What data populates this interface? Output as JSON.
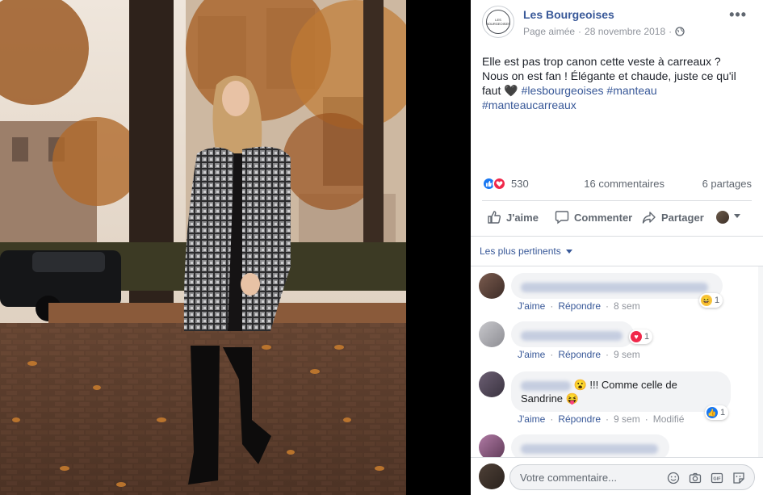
{
  "post": {
    "page_name": "Les Bourgeoises",
    "page_logo_text": "LES BOURGEOISES",
    "meta_status": "Page aimée",
    "meta_sep": "·",
    "meta_date": "28 novembre 2018",
    "meta_sep2": "·",
    "text_line1": "Elle est pas trop canon cette veste à carreaux ?",
    "text_line2": "Nous on est fan ! Élégante et chaude, juste ce qu'il",
    "text_line3_prefix": "faut 🖤 ",
    "hashtag1": "#lesbourgeoises",
    "hashtag2": "#manteau",
    "hashtag3": "#manteaucarreaux",
    "reactions_count": "530",
    "comments_count": "16 commentaires",
    "shares_count": "6 partages"
  },
  "actions": {
    "like": "J'aime",
    "comment": "Commenter",
    "share": "Partager"
  },
  "sort": {
    "label": "Les plus pertinents"
  },
  "comments": [
    {
      "text": "",
      "like": "J'aime",
      "reply": "Répondre",
      "time": "8 sem",
      "reaction_count": "1",
      "extra": ""
    },
    {
      "text": "",
      "like": "J'aime",
      "reply": "Répondre",
      "time": "9 sem",
      "reaction_count": "1",
      "extra": ""
    },
    {
      "text_a": "😮 !!! Comme celle de",
      "text_b": "Sandrine 😝",
      "like": "J'aime",
      "reply": "Répondre",
      "time": "9 sem",
      "reaction_count": "1",
      "extra": "Modifié"
    }
  ],
  "composer": {
    "placeholder": "Votre commentaire..."
  },
  "colors": {
    "link": "#385898",
    "like_blue": "#1877f2",
    "love_red": "#f0284a"
  }
}
